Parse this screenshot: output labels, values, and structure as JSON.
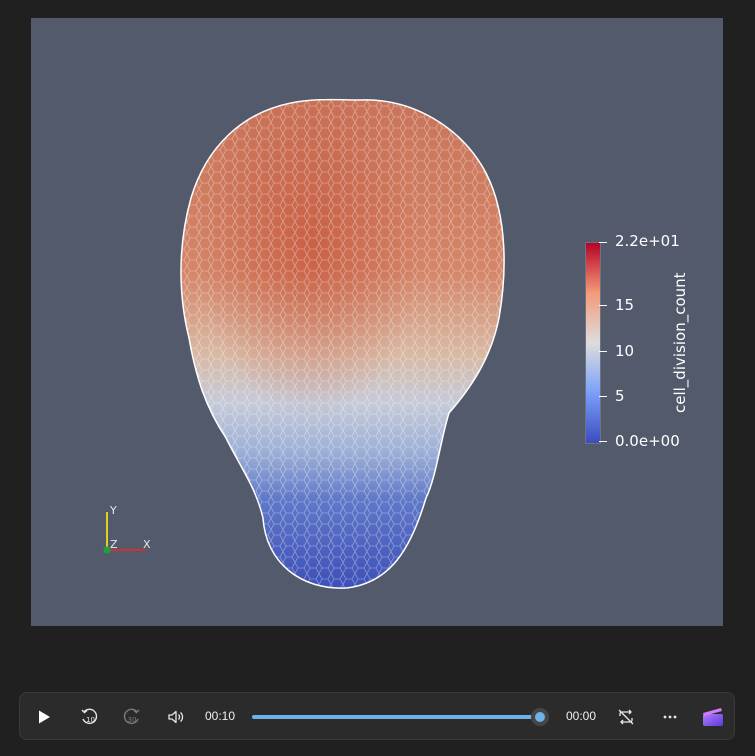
{
  "viewer": {
    "colorbar": {
      "title": "cell_division_count",
      "max_label": "2.2e+01",
      "label_15": "15",
      "label_10": "10",
      "label_5": "5",
      "min_label": "0.0e+00",
      "colors": [
        "#3b4cc0",
        "#dddddd",
        "#b40426"
      ]
    },
    "axes": {
      "y": "Y",
      "z": "Z",
      "x": "X"
    }
  },
  "player": {
    "current_time": "00:10",
    "remaining_time": "00:00",
    "progress": 1.0,
    "icons": [
      "play-icon",
      "rewind-10-icon",
      "forward-30-icon",
      "volume-icon",
      "repeat-off-icon",
      "more-icon",
      "clipchamp-icon"
    ],
    "accent": "#6bb3e8"
  }
}
